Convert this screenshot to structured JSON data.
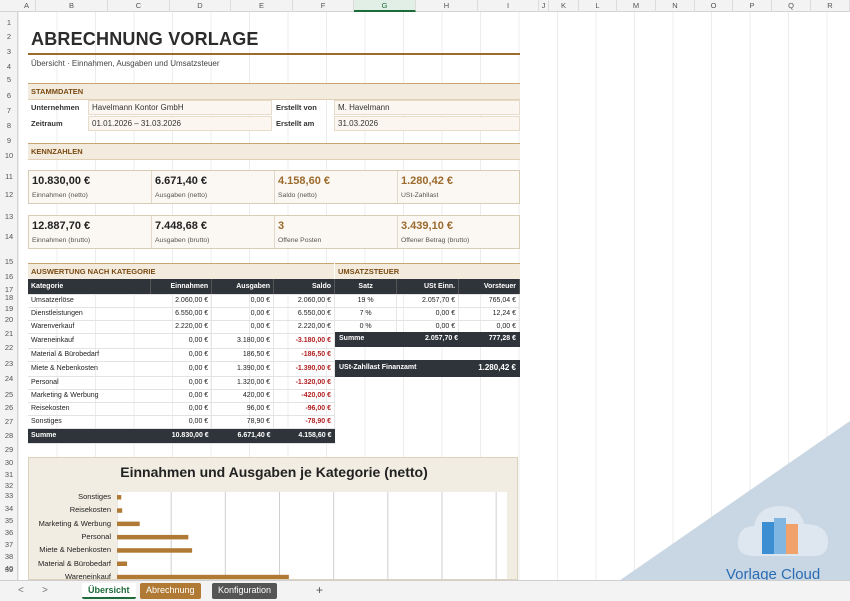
{
  "columns": [
    "A",
    "B",
    "C",
    "D",
    "E",
    "F",
    "G",
    "H",
    "I",
    "J",
    "K",
    "L",
    "M",
    "N",
    "O",
    "P",
    "Q",
    "R"
  ],
  "rows": [
    "1",
    "2",
    "3",
    "4",
    "5",
    "6",
    "7",
    "8",
    "9",
    "10",
    "11",
    "12",
    "13",
    "14",
    "15",
    "16",
    "17",
    "18",
    "19",
    "20",
    "21",
    "22",
    "23",
    "24",
    "25",
    "26",
    "27",
    "28",
    "29",
    "30",
    "31",
    "32",
    "33",
    "34",
    "35",
    "36",
    "37",
    "38",
    "39",
    "40"
  ],
  "title": "ABRECHNUNG VORLAGE",
  "subtitle": "Übersicht · Einnahmen, Ausgaben und Umsatzsteuer",
  "stammdaten": {
    "header": "STAMMDATEN",
    "unternehmen_label": "Unternehmen",
    "unternehmen_value": "Havelmann Kontor GmbH",
    "zeitraum_label": "Zeitraum",
    "zeitraum_value": "01.01.2026 – 31.03.2026",
    "erstellt_von_label": "Erstellt von",
    "erstellt_von_value": "M. Havelmann",
    "erstellt_am_label": "Erstellt am",
    "erstellt_am_value": "31.03.2026"
  },
  "kennzahlen": {
    "header": "KENNZAHLEN",
    "row1": [
      {
        "value": "10.830,00 €",
        "caption": "Einnahmen (netto)"
      },
      {
        "value": "6.671,40 €",
        "caption": "Ausgaben (netto)"
      },
      {
        "value": "4.158,60 €",
        "caption": "Saldo (netto)"
      },
      {
        "value": "1.280,42 €",
        "caption": "USt-Zahllast"
      }
    ],
    "row2": [
      {
        "value": "12.887,70 €",
        "caption": "Einnahmen (brutto)"
      },
      {
        "value": "7.448,68 €",
        "caption": "Ausgaben (brutto)"
      },
      {
        "value": "3",
        "caption": "Offene Posten"
      },
      {
        "value": "3.439,10 €",
        "caption": "Offener Betrag (brutto)"
      }
    ]
  },
  "auswertung": {
    "header": "AUSWERTUNG NACH KATEGORIE",
    "columns": [
      "Kategorie",
      "Einnahmen",
      "Ausgaben",
      "Saldo"
    ],
    "rows": [
      [
        "Umsatzerlöse",
        "2.060,00 €",
        "0,00 €",
        "2.060,00 €"
      ],
      [
        "Dienstleistungen",
        "6.550,00 €",
        "0,00 €",
        "6.550,00 €"
      ],
      [
        "Warenverkauf",
        "2.220,00 €",
        "0,00 €",
        "2.220,00 €"
      ],
      [
        "Wareneinkauf",
        "0,00 €",
        "3.180,00 €",
        "-3.180,00 €"
      ],
      [
        "Material & Bürobedarf",
        "0,00 €",
        "186,50 €",
        "-186,50 €"
      ],
      [
        "Miete & Nebenkosten",
        "0,00 €",
        "1.390,00 €",
        "-1.390,00 €"
      ],
      [
        "Personal",
        "0,00 €",
        "1.320,00 €",
        "-1.320,00 €"
      ],
      [
        "Marketing & Werbung",
        "0,00 €",
        "420,00 €",
        "-420,00 €"
      ],
      [
        "Reisekosten",
        "0,00 €",
        "96,00 €",
        "-96,00 €"
      ],
      [
        "Sonstiges",
        "0,00 €",
        "78,90 €",
        "-78,90 €"
      ]
    ],
    "sum": [
      "Summe",
      "10.830,00 €",
      "6.671,40 €",
      "4.158,60 €"
    ]
  },
  "umsatzsteuer": {
    "header": "UMSATZSTEUER",
    "columns": [
      "Satz",
      "USt Einn.",
      "Vorsteuer"
    ],
    "rows": [
      [
        "19 %",
        "2.057,70 €",
        "765,04 €"
      ],
      [
        "7 %",
        "0,00 €",
        "12,24 €"
      ],
      [
        "0 %",
        "0,00 €",
        "0,00 €"
      ]
    ],
    "sum_label": "Summe",
    "sum_ust": "2.057,70 €",
    "sum_vorsteuer": "777,28 €",
    "zahllast_label": "USt-Zahllast Finanzamt",
    "zahllast_value": "1.280,42 €"
  },
  "chart_data": {
    "type": "bar",
    "orientation": "horizontal",
    "title": "Einnahmen und Ausgaben je Kategorie (netto)",
    "categories": [
      "Sonstiges",
      "Reisekosten",
      "Marketing & Werbung",
      "Personal",
      "Miete & Nebenkosten",
      "Material & Bürobedarf",
      "Wareneinkauf"
    ],
    "series": [
      {
        "values": [
          78.9,
          96,
          420,
          1320,
          1390,
          186.5,
          3180
        ]
      }
    ],
    "xlim": [
      0,
      7000
    ],
    "grid": true,
    "bar_color": "#b07a34"
  },
  "sheet_tabs": [
    {
      "label": "Übersicht",
      "active": true
    },
    {
      "label": "Abrechnung",
      "active": false
    },
    {
      "label": "Konfiguration",
      "active": false
    }
  ],
  "add_sheet": "+",
  "nav_prev": "<",
  "nav_next": ">",
  "watermark": "Vorlage Cloud"
}
